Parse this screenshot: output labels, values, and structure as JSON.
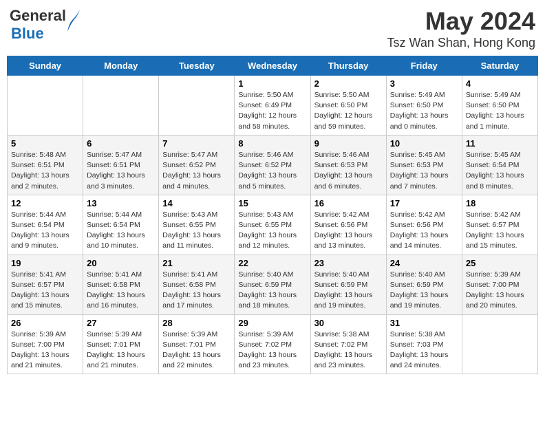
{
  "header": {
    "logo_line1": "General",
    "logo_line2": "Blue",
    "main_title": "May 2024",
    "subtitle": "Tsz Wan Shan, Hong Kong"
  },
  "days_of_week": [
    "Sunday",
    "Monday",
    "Tuesday",
    "Wednesday",
    "Thursday",
    "Friday",
    "Saturday"
  ],
  "weeks": [
    [
      {
        "day": "",
        "info": ""
      },
      {
        "day": "",
        "info": ""
      },
      {
        "day": "",
        "info": ""
      },
      {
        "day": "1",
        "info": "Sunrise: 5:50 AM\nSunset: 6:49 PM\nDaylight: 12 hours\nand 58 minutes."
      },
      {
        "day": "2",
        "info": "Sunrise: 5:50 AM\nSunset: 6:50 PM\nDaylight: 12 hours\nand 59 minutes."
      },
      {
        "day": "3",
        "info": "Sunrise: 5:49 AM\nSunset: 6:50 PM\nDaylight: 13 hours\nand 0 minutes."
      },
      {
        "day": "4",
        "info": "Sunrise: 5:49 AM\nSunset: 6:50 PM\nDaylight: 13 hours\nand 1 minute."
      }
    ],
    [
      {
        "day": "5",
        "info": "Sunrise: 5:48 AM\nSunset: 6:51 PM\nDaylight: 13 hours\nand 2 minutes."
      },
      {
        "day": "6",
        "info": "Sunrise: 5:47 AM\nSunset: 6:51 PM\nDaylight: 13 hours\nand 3 minutes."
      },
      {
        "day": "7",
        "info": "Sunrise: 5:47 AM\nSunset: 6:52 PM\nDaylight: 13 hours\nand 4 minutes."
      },
      {
        "day": "8",
        "info": "Sunrise: 5:46 AM\nSunset: 6:52 PM\nDaylight: 13 hours\nand 5 minutes."
      },
      {
        "day": "9",
        "info": "Sunrise: 5:46 AM\nSunset: 6:53 PM\nDaylight: 13 hours\nand 6 minutes."
      },
      {
        "day": "10",
        "info": "Sunrise: 5:45 AM\nSunset: 6:53 PM\nDaylight: 13 hours\nand 7 minutes."
      },
      {
        "day": "11",
        "info": "Sunrise: 5:45 AM\nSunset: 6:54 PM\nDaylight: 13 hours\nand 8 minutes."
      }
    ],
    [
      {
        "day": "12",
        "info": "Sunrise: 5:44 AM\nSunset: 6:54 PM\nDaylight: 13 hours\nand 9 minutes."
      },
      {
        "day": "13",
        "info": "Sunrise: 5:44 AM\nSunset: 6:54 PM\nDaylight: 13 hours\nand 10 minutes."
      },
      {
        "day": "14",
        "info": "Sunrise: 5:43 AM\nSunset: 6:55 PM\nDaylight: 13 hours\nand 11 minutes."
      },
      {
        "day": "15",
        "info": "Sunrise: 5:43 AM\nSunset: 6:55 PM\nDaylight: 13 hours\nand 12 minutes."
      },
      {
        "day": "16",
        "info": "Sunrise: 5:42 AM\nSunset: 6:56 PM\nDaylight: 13 hours\nand 13 minutes."
      },
      {
        "day": "17",
        "info": "Sunrise: 5:42 AM\nSunset: 6:56 PM\nDaylight: 13 hours\nand 14 minutes."
      },
      {
        "day": "18",
        "info": "Sunrise: 5:42 AM\nSunset: 6:57 PM\nDaylight: 13 hours\nand 15 minutes."
      }
    ],
    [
      {
        "day": "19",
        "info": "Sunrise: 5:41 AM\nSunset: 6:57 PM\nDaylight: 13 hours\nand 15 minutes."
      },
      {
        "day": "20",
        "info": "Sunrise: 5:41 AM\nSunset: 6:58 PM\nDaylight: 13 hours\nand 16 minutes."
      },
      {
        "day": "21",
        "info": "Sunrise: 5:41 AM\nSunset: 6:58 PM\nDaylight: 13 hours\nand 17 minutes."
      },
      {
        "day": "22",
        "info": "Sunrise: 5:40 AM\nSunset: 6:59 PM\nDaylight: 13 hours\nand 18 minutes."
      },
      {
        "day": "23",
        "info": "Sunrise: 5:40 AM\nSunset: 6:59 PM\nDaylight: 13 hours\nand 19 minutes."
      },
      {
        "day": "24",
        "info": "Sunrise: 5:40 AM\nSunset: 6:59 PM\nDaylight: 13 hours\nand 19 minutes."
      },
      {
        "day": "25",
        "info": "Sunrise: 5:39 AM\nSunset: 7:00 PM\nDaylight: 13 hours\nand 20 minutes."
      }
    ],
    [
      {
        "day": "26",
        "info": "Sunrise: 5:39 AM\nSunset: 7:00 PM\nDaylight: 13 hours\nand 21 minutes."
      },
      {
        "day": "27",
        "info": "Sunrise: 5:39 AM\nSunset: 7:01 PM\nDaylight: 13 hours\nand 21 minutes."
      },
      {
        "day": "28",
        "info": "Sunrise: 5:39 AM\nSunset: 7:01 PM\nDaylight: 13 hours\nand 22 minutes."
      },
      {
        "day": "29",
        "info": "Sunrise: 5:39 AM\nSunset: 7:02 PM\nDaylight: 13 hours\nand 23 minutes."
      },
      {
        "day": "30",
        "info": "Sunrise: 5:38 AM\nSunset: 7:02 PM\nDaylight: 13 hours\nand 23 minutes."
      },
      {
        "day": "31",
        "info": "Sunrise: 5:38 AM\nSunset: 7:03 PM\nDaylight: 13 hours\nand 24 minutes."
      },
      {
        "day": "",
        "info": ""
      }
    ]
  ]
}
